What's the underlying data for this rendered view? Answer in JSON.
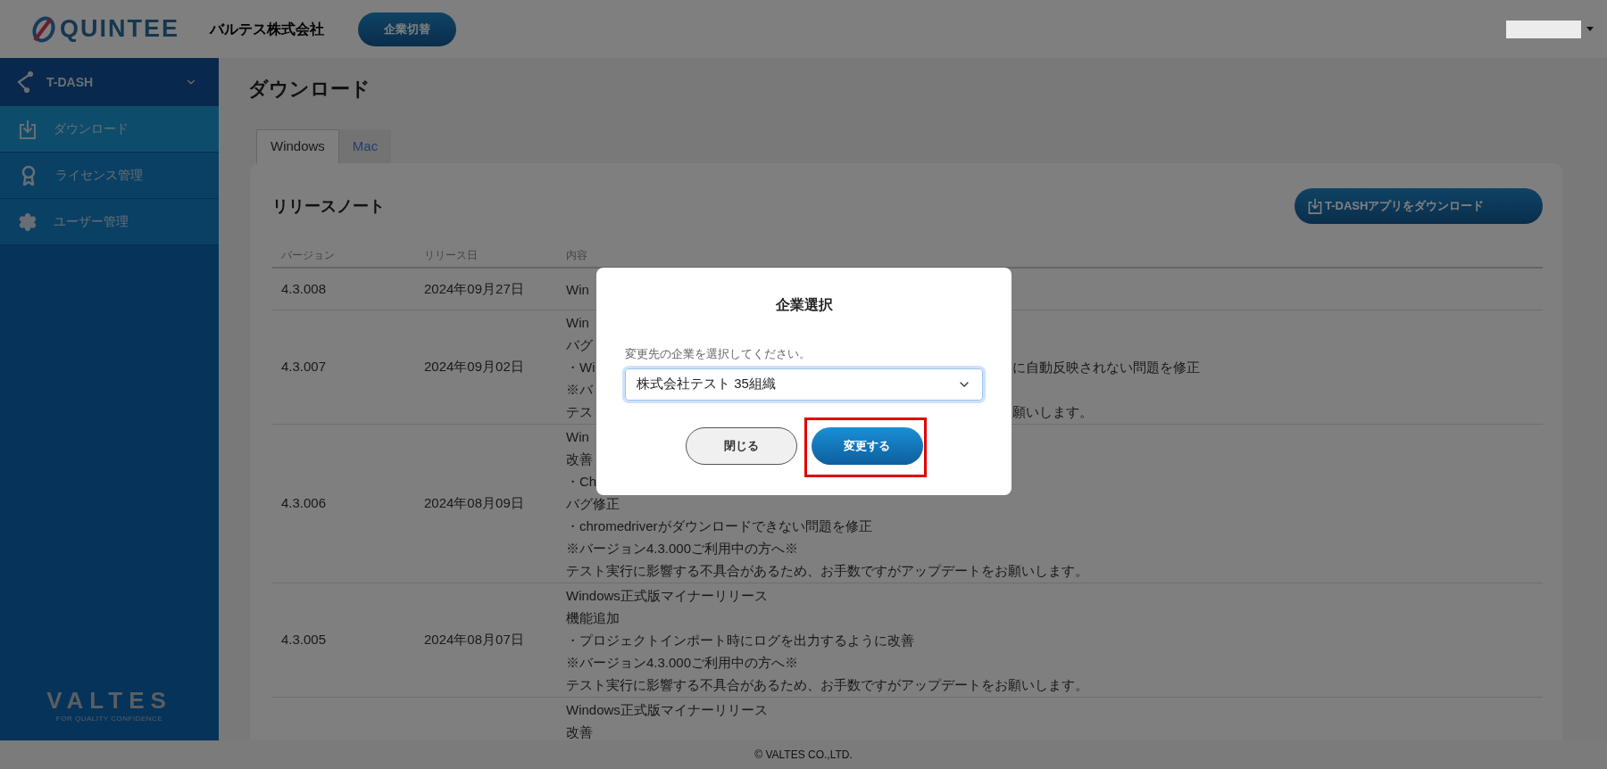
{
  "header": {
    "logo": "QUINTEE",
    "company": "バルテス株式会社",
    "switch_button": "企業切替"
  },
  "sidebar": {
    "section": {
      "label": "T-DASH",
      "expanded": true
    },
    "items": [
      {
        "label": "ダウンロード",
        "kind": "download",
        "selected": true
      },
      {
        "label": "ライセンス管理",
        "kind": "award",
        "selected": false
      },
      {
        "label": "ユーザー管理",
        "kind": "gear",
        "selected": false
      }
    ],
    "brand": {
      "name": "VALTES",
      "tagline": "FOR QUALITY CONFIDENCE"
    }
  },
  "page": {
    "title": "ダウンロード",
    "tabs": [
      {
        "label": "Windows",
        "selected": true
      },
      {
        "label": "Mac",
        "selected": false
      }
    ],
    "card": {
      "title": "リリースノート",
      "download_button": "T-DASHアプリをダウンロード",
      "columns": [
        "バージョン",
        "リリース日",
        "内容"
      ],
      "rows": [
        {
          "version": "4.3.008",
          "date": "2024年09月27日",
          "lines": [
            {
              "text": "Win"
            }
          ]
        },
        {
          "version": "4.3.007",
          "date": "2024年09月02日",
          "lines": [
            {
              "text": "Win"
            },
            {
              "text": "バグ"
            },
            {
              "text": "・Wi",
              "right": "に自動反映されない問題を修正"
            },
            {
              "text": "※バ"
            },
            {
              "text": "テス",
              "right": "願いします。"
            }
          ]
        },
        {
          "version": "4.3.006",
          "date": "2024年08月09日",
          "lines": [
            {
              "text": "Win"
            },
            {
              "text": "改善"
            },
            {
              "text": "・Ch"
            },
            {
              "text": "バグ修正"
            },
            {
              "text": "・chromedriverがダウンロードできない問題を修正"
            },
            {
              "text": "※バージョン4.3.000ご利用中の方へ※"
            },
            {
              "text": "テスト実行に影響する不具合があるため、お手数ですがアップデートをお願いします。"
            }
          ]
        },
        {
          "version": "4.3.005",
          "date": "2024年08月07日",
          "lines": [
            {
              "text": "Windows正式版マイナーリリース"
            },
            {
              "text": "機能追加"
            },
            {
              "text": "・プロジェクトインポート時にログを出力するように改善"
            },
            {
              "text": "※バージョン4.3.000ご利用中の方へ※"
            },
            {
              "text": "テスト実行に影響する不具合があるため、お手数ですがアップデートをお願いします。"
            }
          ]
        },
        {
          "lines": [
            {
              "text": "Windows正式版マイナーリリース"
            },
            {
              "text": "改善"
            }
          ]
        }
      ]
    }
  },
  "dialog": {
    "title": "企業選択",
    "label": "変更先の企業を選択してください。",
    "select_value": "株式会社テスト 35組織",
    "buttons": [
      {
        "label": "閉じる",
        "kind": "secondary",
        "highlighted": false
      },
      {
        "label": "変更する",
        "kind": "primary",
        "highlighted": true
      }
    ]
  },
  "footer": {
    "copyright": "© VALTES CO.,LTD."
  }
}
